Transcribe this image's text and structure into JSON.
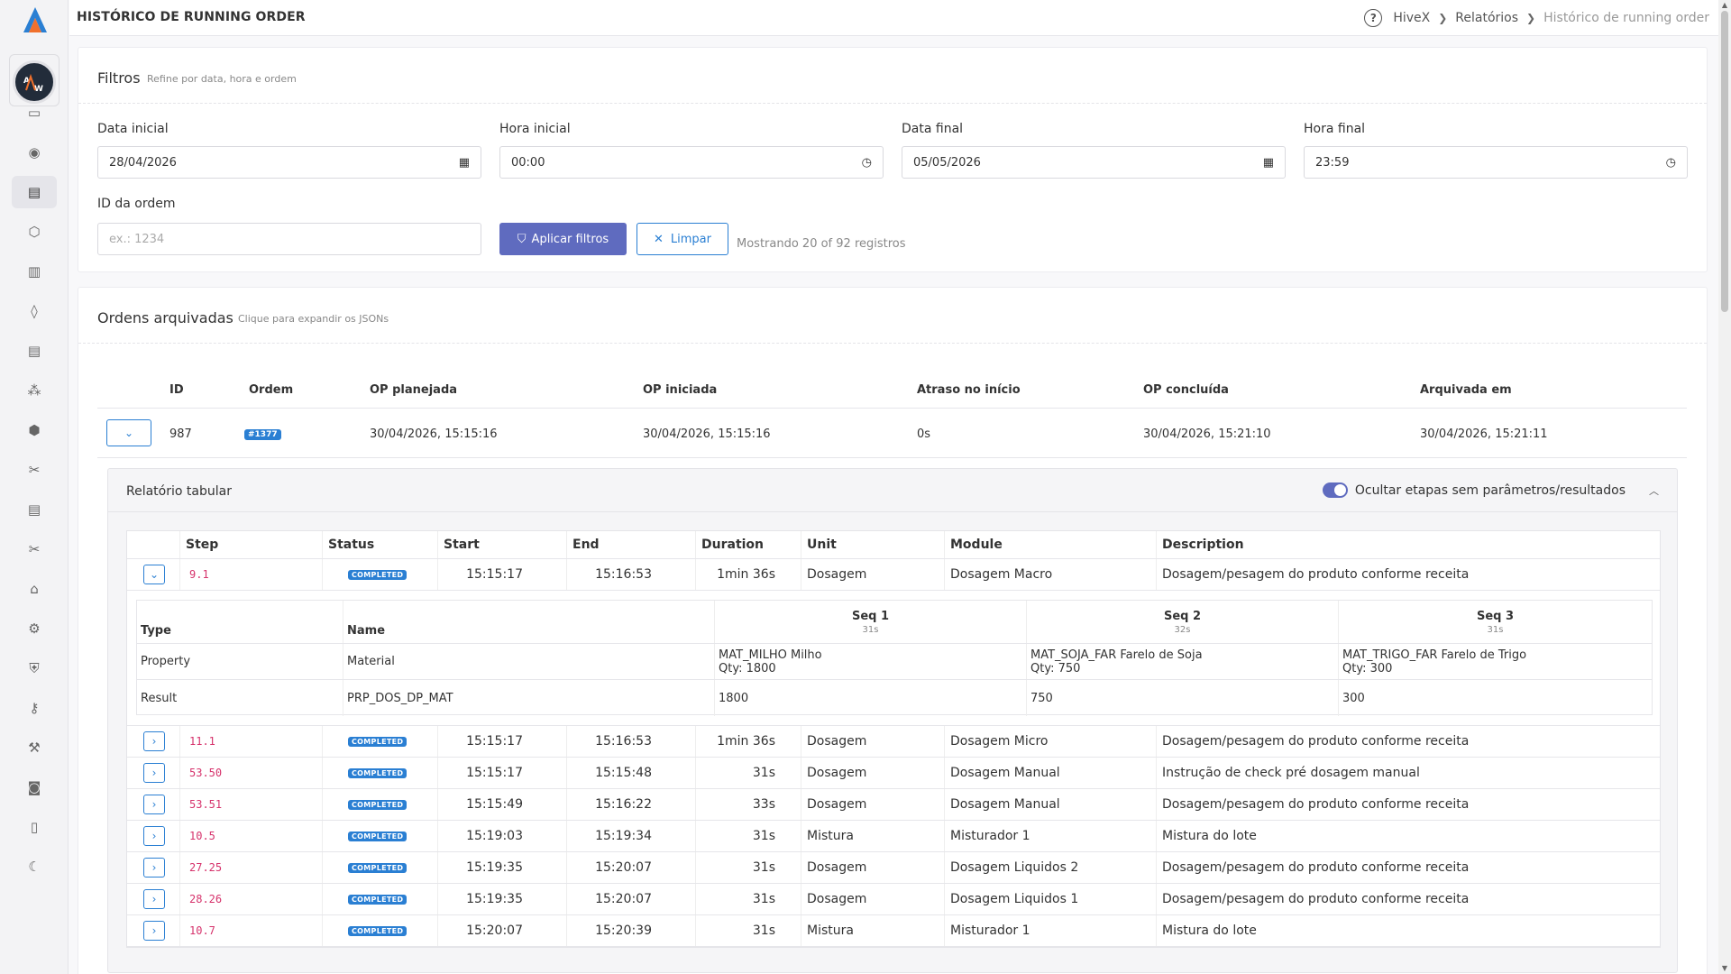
{
  "header": {
    "title": "HISTÓRICO DE RUNNING ORDER",
    "breadcrumb": [
      "HiveX",
      "Relatórios",
      "Histórico de running order"
    ]
  },
  "sidebar": {
    "avatar_letters": "A W",
    "icons": [
      "chat-icon",
      "gauge-icon",
      "clipboard-icon",
      "cube-icon",
      "document-icon",
      "drop-icon",
      "clipboard-list-icon",
      "nodes-icon",
      "box-icon",
      "tools-icon",
      "ledger-icon",
      "tools-cross-icon",
      "stand-icon",
      "settings-icon",
      "shield-icon",
      "key-icon",
      "wrench-icon",
      "account-icon",
      "panel-icon",
      "moon-icon"
    ],
    "active_index": 2
  },
  "filters": {
    "title": "Filtros",
    "subtitle": "Refine por data, hora e ordem",
    "start_date_label": "Data inicial",
    "start_date_value": "28/04/2026",
    "start_time_label": "Hora inicial",
    "start_time_value": "00:00",
    "end_date_label": "Data final",
    "end_date_value": "05/05/2026",
    "end_time_label": "Hora final",
    "end_time_value": "23:59",
    "order_id_label": "ID da ordem",
    "order_id_placeholder": "ex.: 1234",
    "apply_label": "Aplicar filtros",
    "clear_label": "Limpar",
    "showing_text": "Mostrando 20 of 92 registros"
  },
  "orders": {
    "title": "Ordens arquivadas",
    "subtitle": "Clique para expandir os JSONs",
    "columns": [
      "ID",
      "Ordem",
      "OP planejada",
      "OP iniciada",
      "Atraso no início",
      "OP concluída",
      "Arquivada em"
    ],
    "row": {
      "id": "987",
      "order": "#1377",
      "planned": "30/04/2026, 15:15:16",
      "started": "30/04/2026, 15:15:16",
      "delay": "0s",
      "completed": "30/04/2026, 15:21:10",
      "archived": "30/04/2026, 15:21:11"
    }
  },
  "report": {
    "title": "Relatório tabular",
    "toggle_label": "Ocultar etapas sem parâmetros/resultados",
    "toggle_on": true,
    "step_columns": [
      "Step",
      "Status",
      "Start",
      "End",
      "Duration",
      "Unit",
      "Module",
      "Description"
    ],
    "status_color": "#2a7fd3",
    "steps": [
      {
        "step": "9.1",
        "status": "COMPLETED",
        "start": "15:15:17",
        "end": "15:16:53",
        "duration": "1min 36s",
        "unit": "Dosagem",
        "module": "Dosagem Macro",
        "description": "Dosagem/pesagem do produto conforme receita",
        "expanded": true
      },
      {
        "step": "11.1",
        "status": "COMPLETED",
        "start": "15:15:17",
        "end": "15:16:53",
        "duration": "1min 36s",
        "unit": "Dosagem",
        "module": "Dosagem Micro",
        "description": "Dosagem/pesagem do produto conforme receita"
      },
      {
        "step": "53.50",
        "status": "COMPLETED",
        "start": "15:15:17",
        "end": "15:15:48",
        "duration": "31s",
        "unit": "Dosagem",
        "module": "Dosagem Manual",
        "description": "Instrução de check pré dosagem manual"
      },
      {
        "step": "53.51",
        "status": "COMPLETED",
        "start": "15:15:49",
        "end": "15:16:22",
        "duration": "33s",
        "unit": "Dosagem",
        "module": "Dosagem Manual",
        "description": "Dosagem/pesagem do produto conforme receita"
      },
      {
        "step": "10.5",
        "status": "COMPLETED",
        "start": "15:19:03",
        "end": "15:19:34",
        "duration": "31s",
        "unit": "Mistura",
        "module": "Misturador 1",
        "description": "Mistura do lote"
      },
      {
        "step": "27.25",
        "status": "COMPLETED",
        "start": "15:19:35",
        "end": "15:20:07",
        "duration": "31s",
        "unit": "Dosagem",
        "module": "Dosagem Liquidos 2",
        "description": "Dosagem/pesagem do produto conforme receita"
      },
      {
        "step": "28.26",
        "status": "COMPLETED",
        "start": "15:19:35",
        "end": "15:20:07",
        "duration": "31s",
        "unit": "Dosagem",
        "module": "Dosagem Liquidos 1",
        "description": "Dosagem/pesagem do produto conforme receita"
      },
      {
        "step": "10.7",
        "status": "COMPLETED",
        "start": "15:20:07",
        "end": "15:20:39",
        "duration": "31s",
        "unit": "Mistura",
        "module": "Misturador 1",
        "description": "Mistura do lote"
      }
    ],
    "detail": {
      "type_label": "Type",
      "name_label": "Name",
      "seqs": [
        {
          "label": "Seq 1",
          "duration": "31s"
        },
        {
          "label": "Seq 2",
          "duration": "32s"
        },
        {
          "label": "Seq 3",
          "duration": "31s"
        }
      ],
      "rows": [
        {
          "type": "Property",
          "name": "Material",
          "values": [
            [
              "MAT_MILHO Milho",
              "Qty: 1800"
            ],
            [
              "MAT_SOJA_FAR Farelo de Soja",
              "Qty: 750"
            ],
            [
              "MAT_TRIGO_FAR Farelo de Trigo",
              "Qty: 300"
            ]
          ]
        },
        {
          "type": "Result",
          "name": "PRP_DOS_DP_MAT",
          "values": [
            [
              "1800"
            ],
            [
              "750"
            ],
            [
              "300"
            ]
          ]
        }
      ]
    }
  }
}
